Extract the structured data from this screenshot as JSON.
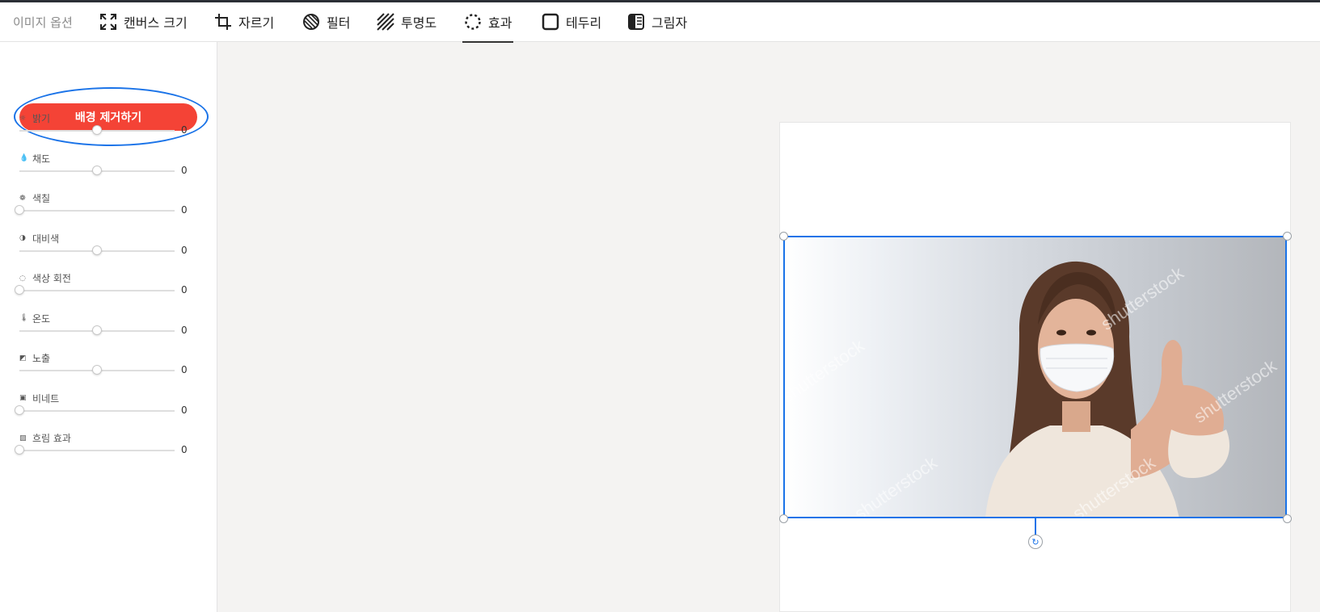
{
  "toolbar": {
    "title": "이미지 옵션",
    "tools": [
      {
        "label": "캔버스 크기",
        "icon": "expand-icon"
      },
      {
        "label": "자르기",
        "icon": "crop-icon"
      },
      {
        "label": "필터",
        "icon": "filter-icon"
      },
      {
        "label": "투명도",
        "icon": "transparency-icon"
      },
      {
        "label": "효과",
        "icon": "effects-icon",
        "active": true
      },
      {
        "label": "테두리",
        "icon": "border-icon"
      },
      {
        "label": "그림자",
        "icon": "shadow-icon"
      }
    ]
  },
  "sidebar": {
    "bg_remove_label": "배경 제거하기",
    "adjustments": [
      {
        "label": "밝기",
        "icon": "brightness-icon",
        "value": "0",
        "level": 0.5
      },
      {
        "label": "채도",
        "icon": "saturation-icon",
        "value": "0",
        "level": 0.5
      },
      {
        "label": "색칠",
        "icon": "palette-icon",
        "value": "0",
        "level": 0.0
      },
      {
        "label": "대비색",
        "icon": "contrast-icon",
        "value": "0",
        "level": 0.5
      },
      {
        "label": "색상 회전",
        "icon": "hue-rotate-icon",
        "value": "0",
        "level": 0.0
      },
      {
        "label": "온도",
        "icon": "temperature-icon",
        "value": "0",
        "level": 0.5
      },
      {
        "label": "노출",
        "icon": "exposure-icon",
        "value": "0",
        "level": 0.5
      },
      {
        "label": "비네트",
        "icon": "vignette-icon",
        "value": "0",
        "level": 0.0
      },
      {
        "label": "흐림 효과",
        "icon": "blur-icon",
        "value": "0",
        "level": 0.0
      }
    ]
  },
  "canvas": {
    "watermark": "shutterstock"
  },
  "colors": {
    "accent": "#1a73e8",
    "bg_remove": "#f44336"
  }
}
